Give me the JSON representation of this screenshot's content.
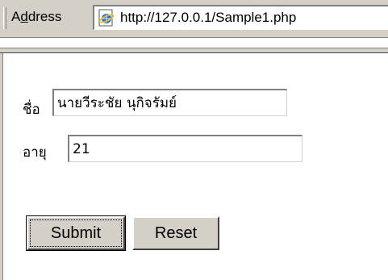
{
  "address_bar": {
    "label": "Address",
    "label_access_key": "d",
    "url": "http://127.0.0.1/Sample1.php",
    "icon": "ie-page-icon"
  },
  "form": {
    "name_label": "ชื่อ",
    "name_value": "นายวีระชัย นุกิจรัมย์",
    "age_label": "อายุ",
    "age_value": "21",
    "submit_label": "Submit",
    "reset_label": "Reset"
  },
  "colors": {
    "chrome": "#d4d0c8",
    "background": "#ffffff"
  }
}
